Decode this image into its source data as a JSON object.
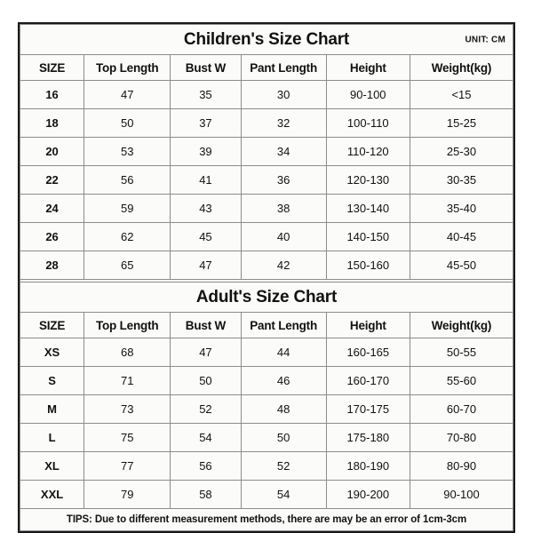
{
  "sheet": {
    "unit_label": "UNIT: CM",
    "accent_color": "#00adee",
    "tips_color": "#ee2222",
    "border_color": "#1a1a1a"
  },
  "children_chart": {
    "title": "Children's Size Chart",
    "columns": [
      "SIZE",
      "Top Length",
      "Bust W",
      "Pant Length",
      "Height",
      "Weight(kg)"
    ],
    "rows": [
      [
        "16",
        "47",
        "35",
        "30",
        "90-100",
        "<15"
      ],
      [
        "18",
        "50",
        "37",
        "32",
        "100-110",
        "15-25"
      ],
      [
        "20",
        "53",
        "39",
        "34",
        "110-120",
        "25-30"
      ],
      [
        "22",
        "56",
        "41",
        "36",
        "120-130",
        "30-35"
      ],
      [
        "24",
        "59",
        "43",
        "38",
        "130-140",
        "35-40"
      ],
      [
        "26",
        "62",
        "45",
        "40",
        "140-150",
        "40-45"
      ],
      [
        "28",
        "65",
        "47",
        "42",
        "150-160",
        "45-50"
      ]
    ]
  },
  "adult_chart": {
    "title": "Adult's Size Chart",
    "columns": [
      "SIZE",
      "Top Length",
      "Bust W",
      "Pant Length",
      "Height",
      "Weight(kg)"
    ],
    "rows": [
      [
        "XS",
        "68",
        "47",
        "44",
        "160-165",
        "50-55"
      ],
      [
        "S",
        "71",
        "50",
        "46",
        "160-170",
        "55-60"
      ],
      [
        "M",
        "73",
        "52",
        "48",
        "170-175",
        "60-70"
      ],
      [
        "L",
        "75",
        "54",
        "50",
        "175-180",
        "70-80"
      ],
      [
        "XL",
        "77",
        "56",
        "52",
        "180-190",
        "80-90"
      ],
      [
        "XXL",
        "79",
        "58",
        "54",
        "190-200",
        "90-100"
      ]
    ]
  },
  "tips": {
    "text": "TIPS: Due to different measurement methods, there are may be an error of 1cm-3cm"
  }
}
